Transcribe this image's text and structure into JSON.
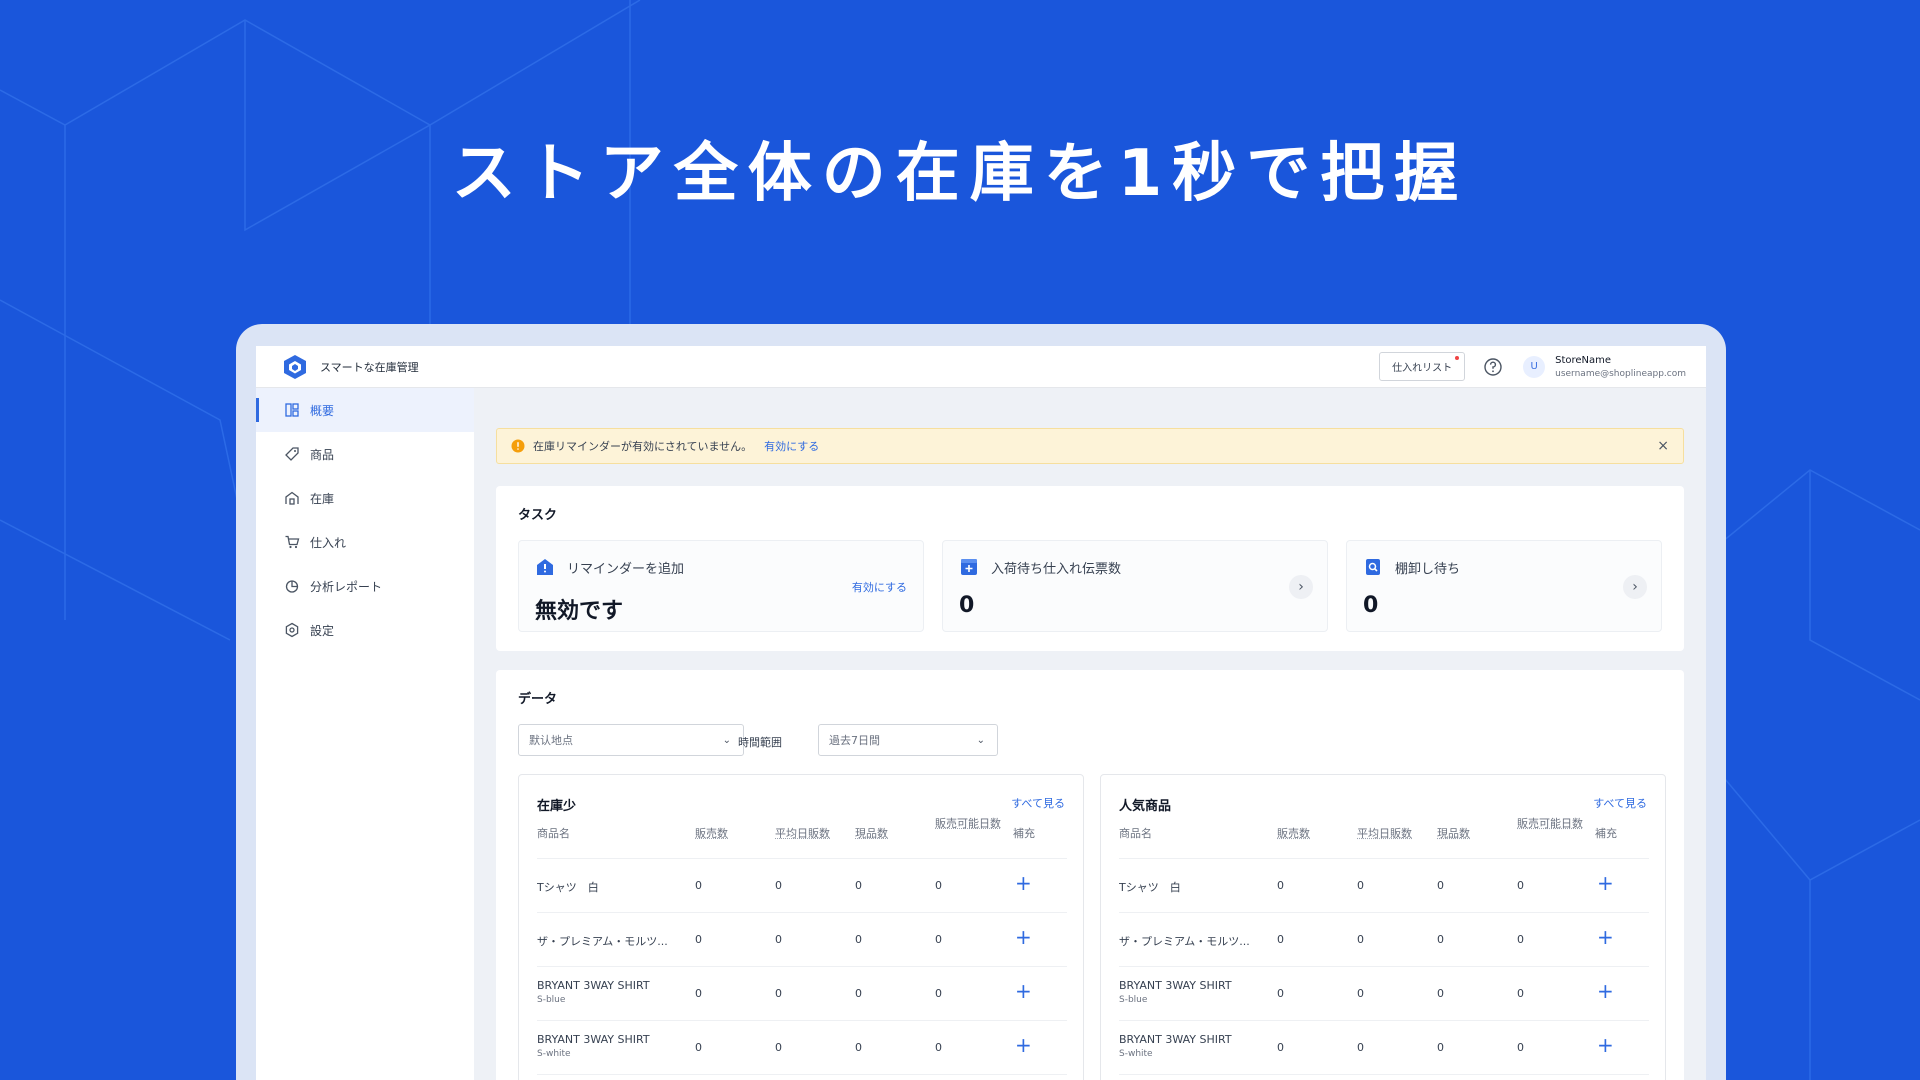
{
  "headline": "ストア全体の在庫を1秒で把握",
  "app": {
    "title": "スマートな在庫管理",
    "purchase_list_label": "仕入れリスト",
    "avatar_letter": "U",
    "store_name": "StoreName",
    "email": "username@shoplineapp.com",
    "accent_color": "#2f6ae0"
  },
  "sidebar": {
    "items": [
      {
        "label": "概要",
        "icon": "dashboard-icon"
      },
      {
        "label": "商品",
        "icon": "tag-icon"
      },
      {
        "label": "在庫",
        "icon": "warehouse-icon"
      },
      {
        "label": "仕入れ",
        "icon": "cart-icon"
      },
      {
        "label": "分析レポート",
        "icon": "pie-chart-icon"
      },
      {
        "label": "設定",
        "icon": "settings-icon"
      }
    ]
  },
  "alert": {
    "text": "在庫リマインダーが有効にされていません。",
    "link": "有効にする",
    "close": "×"
  },
  "tasks": {
    "title": "タスク",
    "items": [
      {
        "label": "リマインダーを追加",
        "value": "無効です",
        "link": "有効にする"
      },
      {
        "label": "入荷待ち仕入れ伝票数",
        "value": "0"
      },
      {
        "label": "棚卸し待ち",
        "value": "0"
      }
    ]
  },
  "data_section": {
    "title": "データ",
    "location_select": "默认地点",
    "range_label": "時間範囲",
    "range_select": "過去7日間"
  },
  "columns": [
    "商品名",
    "販売数",
    "平均日販数",
    "現品数",
    "販売可能日数",
    "補充"
  ],
  "low_stock": {
    "title": "在庫少",
    "more": "すべて見る",
    "rows": [
      {
        "name": "Tシャツ　白",
        "variant": "",
        "sold": "0",
        "avg": "0",
        "stock": "0",
        "days": "0"
      },
      {
        "name": "ザ・プレミアム・モルツ...",
        "variant": "",
        "sold": "0",
        "avg": "0",
        "stock": "0",
        "days": "0"
      },
      {
        "name": "BRYANT 3WAY SHIRT",
        "variant": "S-blue",
        "sold": "0",
        "avg": "0",
        "stock": "0",
        "days": "0"
      },
      {
        "name": "BRYANT 3WAY SHIRT",
        "variant": "S-white",
        "sold": "0",
        "avg": "0",
        "stock": "0",
        "days": "0"
      }
    ]
  },
  "popular": {
    "title": "人気商品",
    "more": "すべて見る",
    "rows": [
      {
        "name": "Tシャツ　白",
        "variant": "",
        "sold": "0",
        "avg": "0",
        "stock": "0",
        "days": "0"
      },
      {
        "name": "ザ・プレミアム・モルツ...",
        "variant": "",
        "sold": "0",
        "avg": "0",
        "stock": "0",
        "days": "0"
      },
      {
        "name": "BRYANT 3WAY SHIRT",
        "variant": "S-blue",
        "sold": "0",
        "avg": "0",
        "stock": "0",
        "days": "0"
      },
      {
        "name": "BRYANT 3WAY SHIRT",
        "variant": "S-white",
        "sold": "0",
        "avg": "0",
        "stock": "0",
        "days": "0"
      }
    ]
  }
}
